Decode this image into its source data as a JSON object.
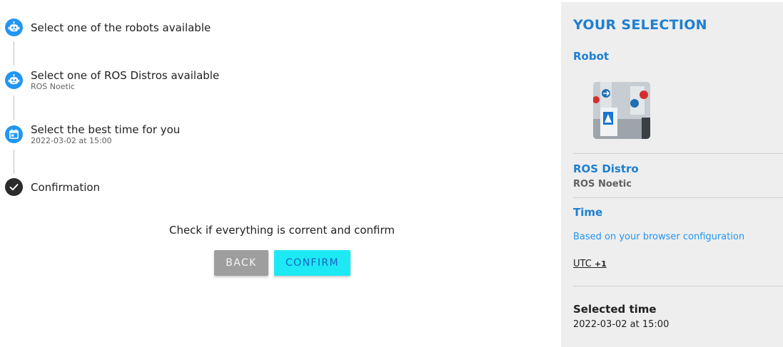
{
  "stepper": {
    "steps": [
      {
        "title": "Select one of the robots available",
        "subtitle": "",
        "icon": "robot-icon"
      },
      {
        "title": "Select one of ROS Distros available",
        "subtitle": "ROS Noetic",
        "icon": "robot-icon"
      },
      {
        "title": "Select the best time for you",
        "subtitle": "2022-03-02 at 15:00",
        "icon": "calendar-icon"
      },
      {
        "title": "Confirmation",
        "subtitle": "",
        "icon": "check-icon"
      }
    ]
  },
  "confirm": {
    "message": "Check if everything is corrent and confirm",
    "back_label": "BACK",
    "confirm_label": "CONFIRM"
  },
  "selection": {
    "title": "YOUR SELECTION",
    "robot_label": "Robot",
    "ros_label": "ROS Distro",
    "ros_value": "ROS Noetic",
    "time_label": "Time",
    "browser_note": "Based on your browser configuration",
    "utc_label": "UTC",
    "utc_offset": "+1",
    "selected_time_label": "Selected time",
    "selected_time_value": "2022-03-02 at 15:00"
  },
  "colors": {
    "accent_blue": "#2196f3",
    "heading_blue": "#1e7fd0",
    "confirm_button": "#1de9f5",
    "back_button": "#9e9e9e",
    "panel_bg": "#eeeeee"
  }
}
